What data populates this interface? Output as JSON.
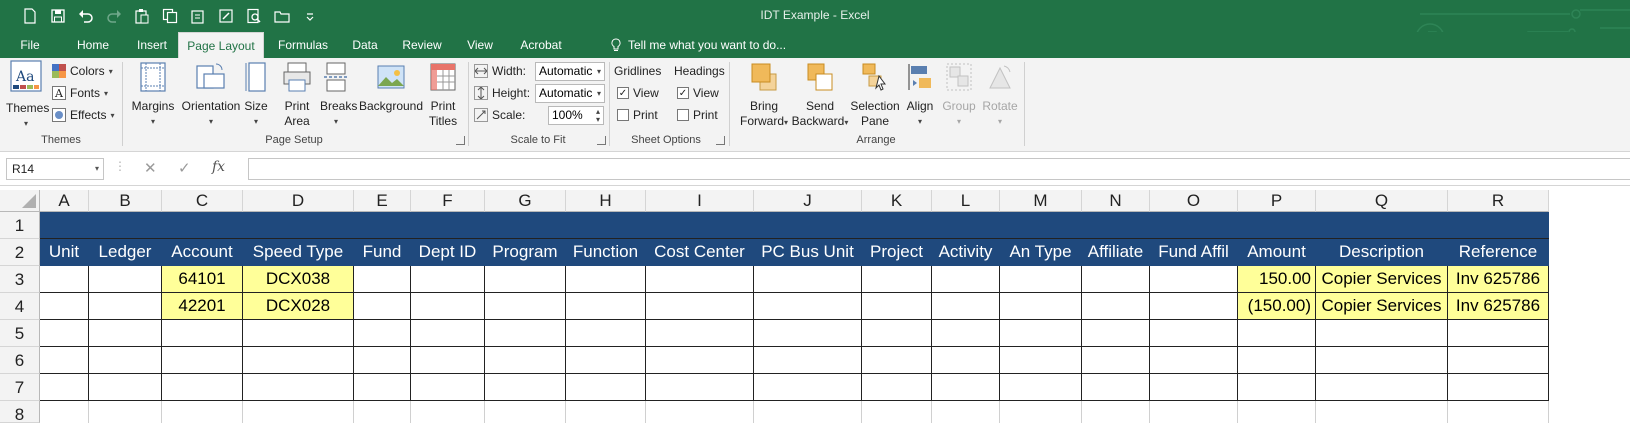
{
  "window": {
    "title": "IDT Example - Excel"
  },
  "colors": {
    "excel_green": "#217346",
    "header_fill": "#1f497d",
    "highlight_fill": "#ffff99"
  },
  "qat": [
    {
      "name": "new-icon"
    },
    {
      "name": "save-icon"
    },
    {
      "name": "undo-icon"
    },
    {
      "name": "redo-icon"
    },
    {
      "name": "paste-icon"
    },
    {
      "name": "copy-icon"
    },
    {
      "name": "paste-special-icon"
    },
    {
      "name": "save-as-icon"
    },
    {
      "name": "print-preview-icon"
    },
    {
      "name": "open-icon"
    },
    {
      "name": "customize-qat-icon"
    }
  ],
  "tabs": {
    "file": "File",
    "home": "Home",
    "insert": "Insert",
    "page_layout": "Page Layout",
    "formulas": "Formulas",
    "data": "Data",
    "review": "Review",
    "view": "View",
    "acrobat": "Acrobat",
    "tell_me": "Tell me what you want to do..."
  },
  "ribbon": {
    "themes": {
      "label": "Themes",
      "colors": "Colors",
      "fonts": "Fonts",
      "effects": "Effects",
      "group": "Themes"
    },
    "page_setup": {
      "margins": "Margins",
      "orientation": "Orientation",
      "size": "Size",
      "print_area_1": "Print",
      "print_area_2": "Area",
      "breaks": "Breaks",
      "background": "Background",
      "print_titles_1": "Print",
      "print_titles_2": "Titles",
      "group": "Page Setup"
    },
    "scale_to_fit": {
      "width_label": "Width:",
      "width_value": "Automatic",
      "height_label": "Height:",
      "height_value": "Automatic",
      "scale_label": "Scale:",
      "scale_value": "100%",
      "group": "Scale to Fit"
    },
    "sheet_options": {
      "gridlines": "Gridlines",
      "headings": "Headings",
      "view": "View",
      "print": "Print",
      "group": "Sheet Options"
    },
    "arrange": {
      "bring_1": "Bring",
      "bring_2": "Forward",
      "send_1": "Send",
      "send_2": "Backward",
      "sel_1": "Selection",
      "sel_2": "Pane",
      "align": "Align",
      "group_btn": "Group",
      "rotate": "Rotate",
      "group": "Arrange"
    }
  },
  "formula_bar": {
    "name_box": "R14",
    "cancel": "✕",
    "enter": "✓",
    "fx": "fx",
    "value": ""
  },
  "columns": [
    "A",
    "B",
    "C",
    "D",
    "E",
    "F",
    "G",
    "H",
    "I",
    "J",
    "K",
    "L",
    "M",
    "N",
    "O",
    "P",
    "Q",
    "R"
  ],
  "rows": [
    "1",
    "2",
    "3",
    "4",
    "5",
    "6",
    "7",
    "8"
  ],
  "sheet": {
    "headers": [
      "Unit",
      "Ledger",
      "Account",
      "Speed Type",
      "Fund",
      "Dept ID",
      "Program",
      "Function",
      "Cost Center",
      "PC Bus Unit",
      "Project",
      "Activity",
      "An Type",
      "Affiliate",
      "Fund Affil",
      "Amount",
      "Description",
      "Reference"
    ],
    "row3": {
      "account": "64101",
      "speed_type": "DCX038",
      "amount": "150.00",
      "description": "Copier Services",
      "reference": "Inv 625786"
    },
    "row4": {
      "account": "42201",
      "speed_type": "DCX028",
      "amount": "(150.00)",
      "description": "Copier Services",
      "reference": "Inv 625786"
    }
  }
}
